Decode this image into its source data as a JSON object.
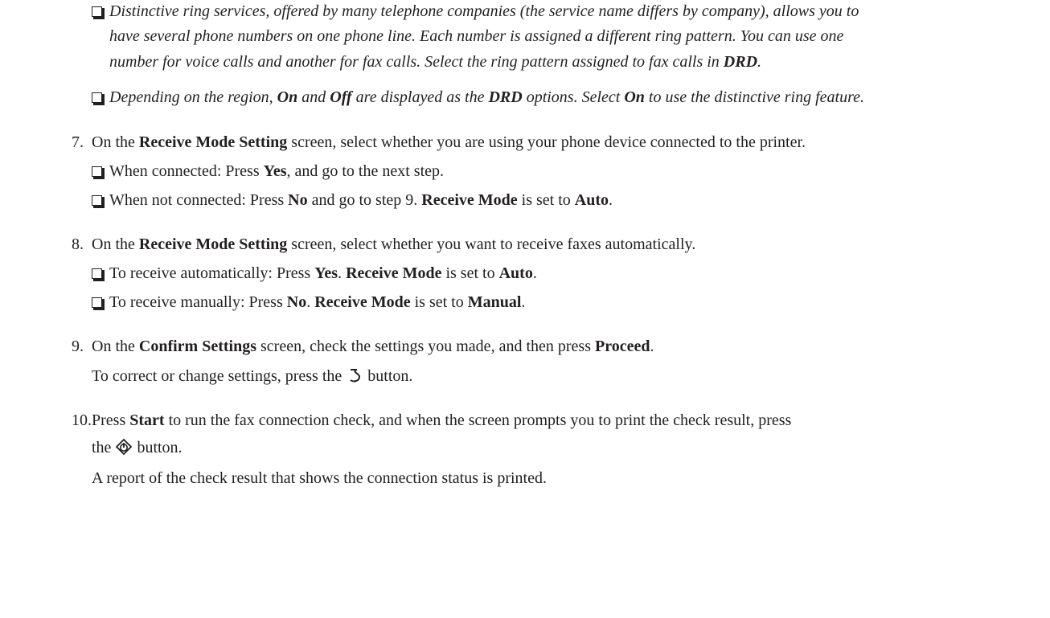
{
  "notes": [
    {
      "l1": "Distinctive ring services, offered by many telephone companies (the service name differs by company), allows you to",
      "l2": "have several phone numbers on one phone line. Each number is assigned a different ring pattern. You can use one",
      "l3a": "number for voice calls and another for fax calls. Select the ring pattern assigned to fax calls in ",
      "l3b": "DRD",
      "l3c": "."
    },
    {
      "a": "Depending on the region, ",
      "b": "On",
      "c": " and ",
      "d": "Off",
      "e": " are displayed as the ",
      "f": "DRD",
      "g": " options. Select ",
      "h": "On",
      "i": " to use the distinctive ring feature."
    }
  ],
  "step7": {
    "num": "7.",
    "a": "On the ",
    "b": "Receive Mode Setting",
    "c": " screen, select whether you are using your phone device connected to the printer.",
    "s1a": "When connected: Press ",
    "s1b": "Yes",
    "s1c": ", and go to the next step.",
    "s2a": "When not connected: Press ",
    "s2b": "No",
    "s2c": " and go to step 9. ",
    "s2d": "Receive Mode",
    "s2e": " is set to ",
    "s2f": "Auto",
    "s2g": "."
  },
  "step8": {
    "num": "8.",
    "a": "On the ",
    "b": "Receive Mode Setting",
    "c": " screen, select whether you want to receive faxes automatically.",
    "s1a": "To receive automatically: Press ",
    "s1b": "Yes",
    "s1c": ". ",
    "s1d": "Receive Mode",
    "s1e": " is set to ",
    "s1f": "Auto",
    "s1g": ".",
    "s2a": "To receive manually: Press ",
    "s2b": "No",
    "s2c": ". ",
    "s2d": "Receive Mode",
    "s2e": " is set to ",
    "s2f": "Manual",
    "s2g": "."
  },
  "step9": {
    "num": "9.",
    "a": "On the ",
    "b": "Confirm Settings",
    "c": " screen, check the settings you made, and then press ",
    "d": "Proceed",
    "e": ".",
    "p2a": "To correct or change settings, press the ",
    "p2b": " button."
  },
  "step10": {
    "num": "10.",
    "a": "Press ",
    "b": "Start",
    "c": " to run the fax connection check, and when the screen prompts you to print the check result, press",
    "l2a": "the ",
    "l2b": " button.",
    "p2": "A report of the check result that shows the connection status is printed."
  },
  "icons": {
    "back": "back-icon",
    "start": "start-icon"
  }
}
